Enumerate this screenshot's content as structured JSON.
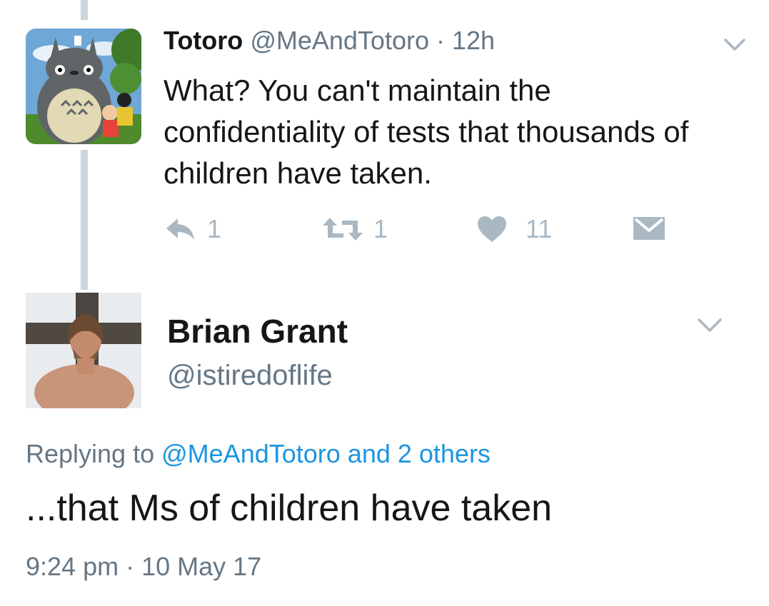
{
  "colors": {
    "muted": "#657786",
    "icon": "#aab8c2",
    "link": "#1b95e0",
    "thread_line": "#ccd6dd"
  },
  "tweet": {
    "author_name": "Totoro",
    "handle": "@MeAndTotoro",
    "separator": "·",
    "time": "12h",
    "text_line1": "What? You can't maintain the",
    "text_line2": "confidentiality of tests that thousands of",
    "text_line3": "children have taken.",
    "actions": {
      "reply_icon": "reply-icon",
      "reply_count": "1",
      "retweet_icon": "retweet-icon",
      "retweet_count": "1",
      "like_icon": "heart-icon",
      "like_count": "11",
      "dm_icon": "envelope-icon"
    }
  },
  "reply": {
    "author_name": "Brian Grant",
    "handle": "@istiredoflife",
    "replying_prefix": "Replying to",
    "replying_to": "@MeAndTotoro and 2 others",
    "text": "...that Ms of children have taken",
    "timestamp": "9:24 pm · 10 May 17"
  }
}
